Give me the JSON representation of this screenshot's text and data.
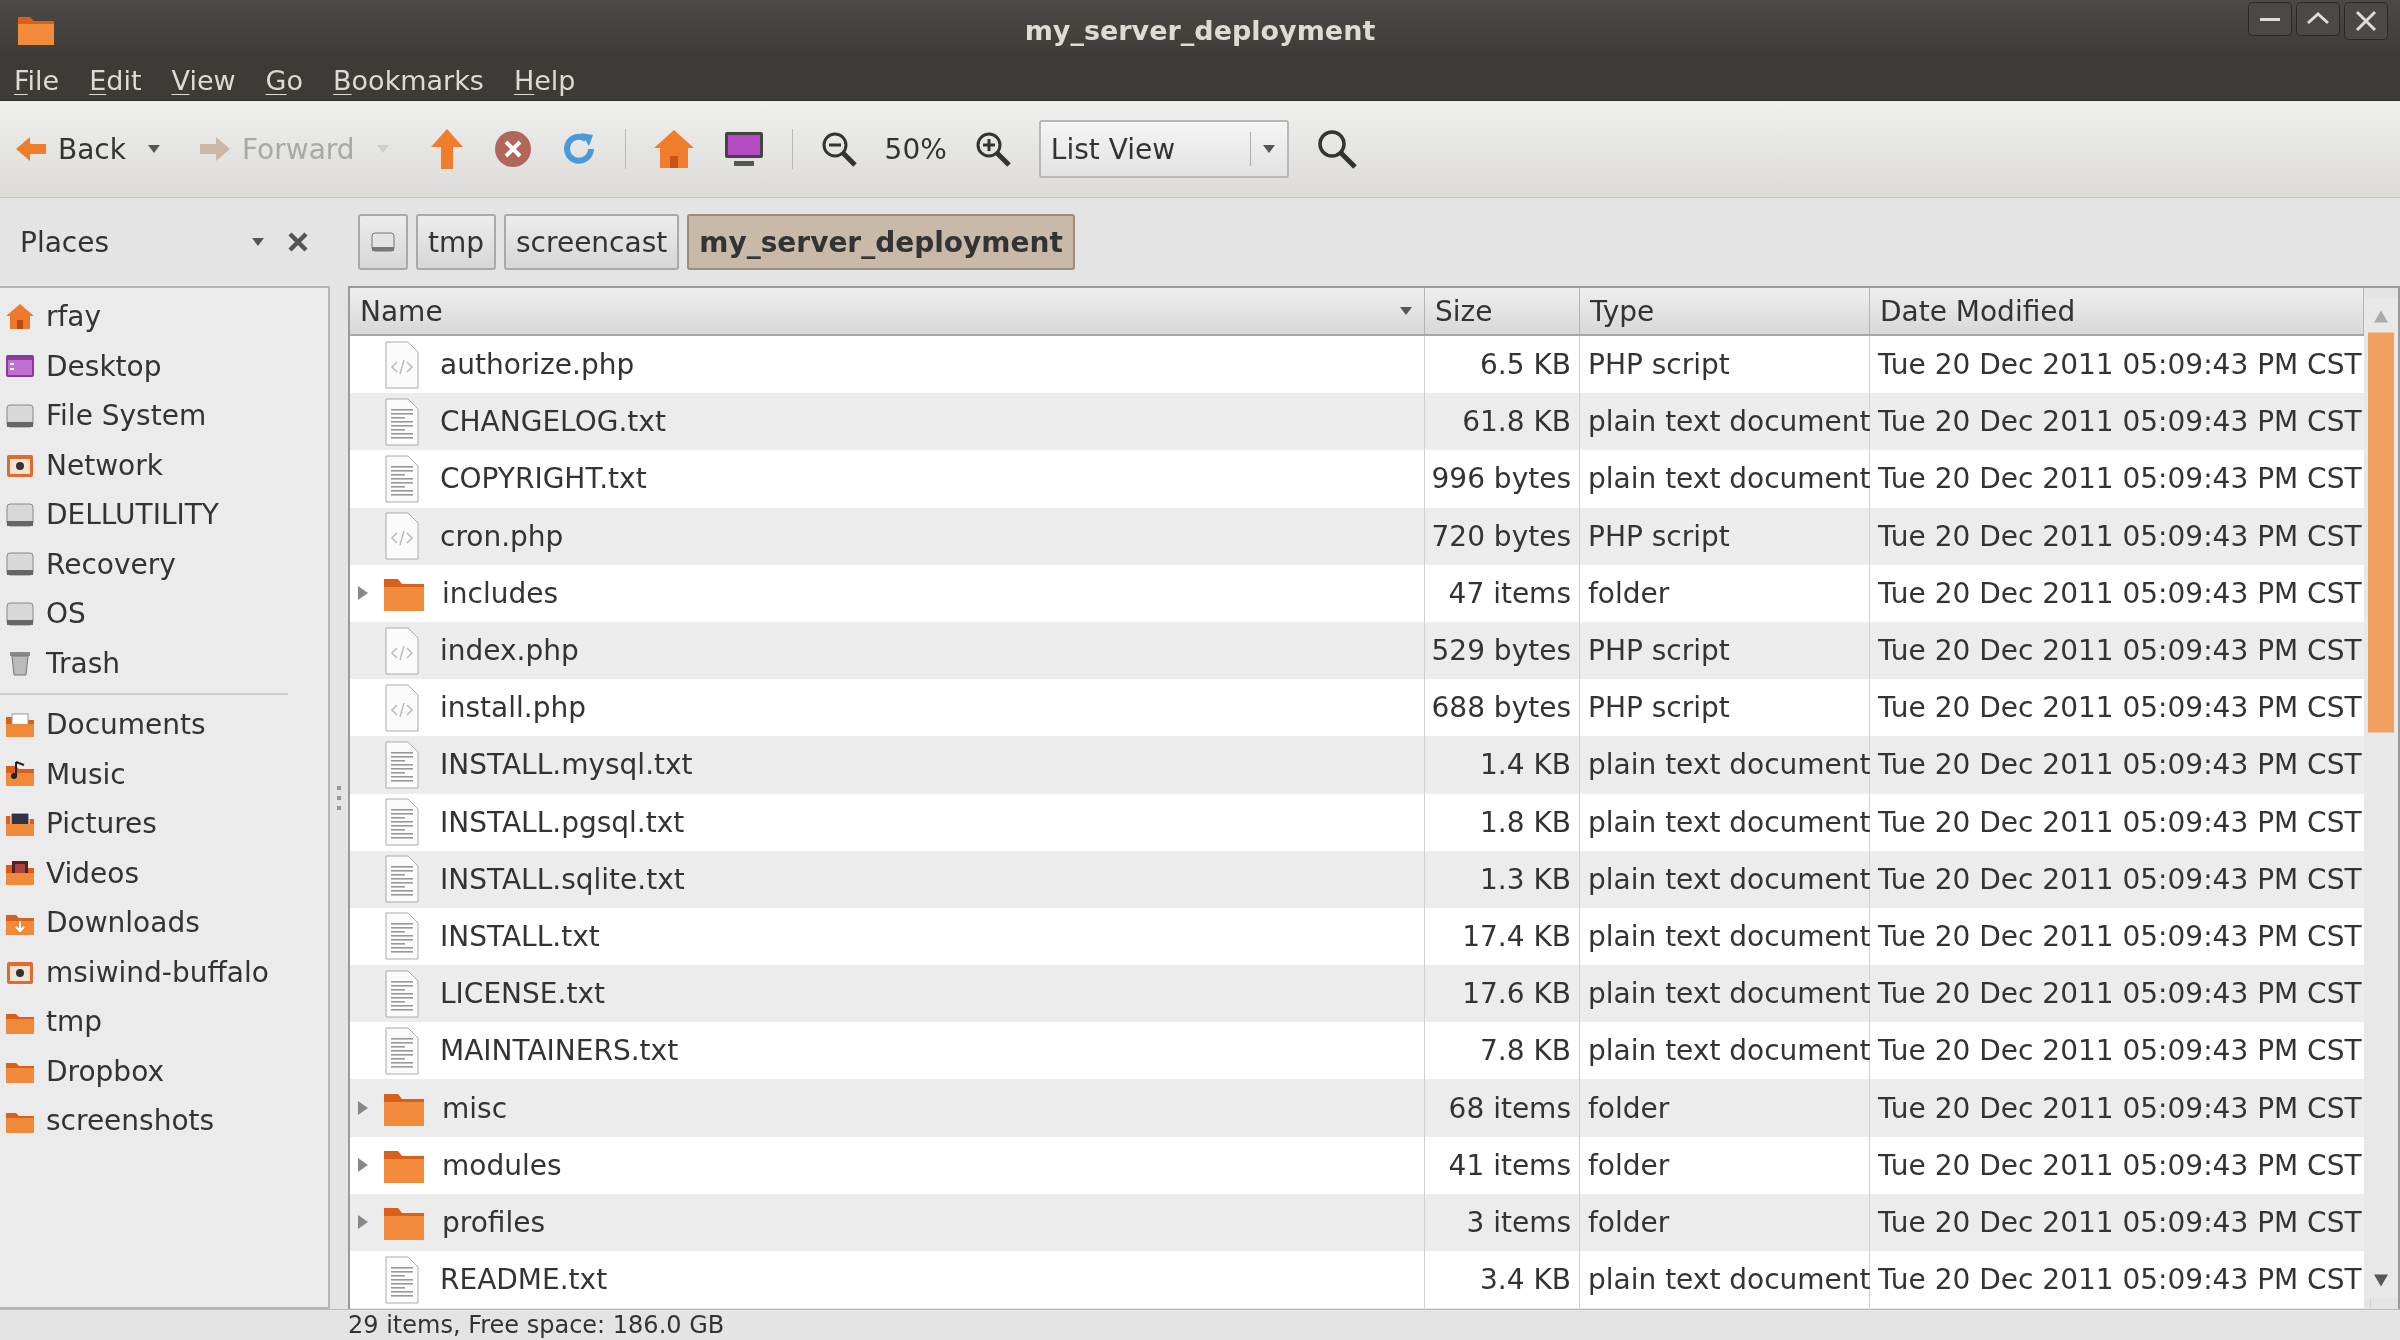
{
  "window": {
    "title": "my_server_deployment"
  },
  "menu": [
    {
      "label": "File"
    },
    {
      "label": "Edit"
    },
    {
      "label": "View"
    },
    {
      "label": "Go"
    },
    {
      "label": "Bookmarks"
    },
    {
      "label": "Help"
    }
  ],
  "toolbar": [
    {
      "kind": "back",
      "label": "Back",
      "disabled": false
    },
    {
      "kind": "forward",
      "label": "Forward",
      "disabled": true
    },
    {
      "kind": "up",
      "disabled": false
    },
    {
      "kind": "stop",
      "disabled": false
    },
    {
      "kind": "reload",
      "disabled": false
    },
    {
      "kind": "sep"
    },
    {
      "kind": "home",
      "disabled": false
    },
    {
      "kind": "computer",
      "disabled": false
    },
    {
      "kind": "sep"
    },
    {
      "kind": "zoom-out",
      "disabled": false
    },
    {
      "kind": "zoom-level",
      "label": "50%"
    },
    {
      "kind": "zoom-in",
      "disabled": false
    },
    {
      "kind": "view",
      "label": "List View"
    },
    {
      "kind": "search",
      "disabled": false
    }
  ],
  "sidebar": {
    "title": "Places",
    "groups": [
      [
        {
          "kind": "home",
          "label": "rfay"
        },
        {
          "kind": "desktop",
          "label": "Desktop"
        },
        {
          "kind": "drive",
          "label": "File System"
        },
        {
          "kind": "network",
          "label": "Network"
        },
        {
          "kind": "drive",
          "label": "DELLUTILITY"
        },
        {
          "kind": "drive",
          "label": "Recovery"
        },
        {
          "kind": "drive",
          "label": "OS"
        },
        {
          "kind": "trash",
          "label": "Trash"
        }
      ],
      [
        {
          "kind": "documents",
          "label": "Documents"
        },
        {
          "kind": "music",
          "label": "Music"
        },
        {
          "kind": "pictures",
          "label": "Pictures"
        },
        {
          "kind": "videos",
          "label": "Videos"
        },
        {
          "kind": "downloads",
          "label": "Downloads"
        },
        {
          "kind": "network",
          "label": "msiwind-buffalo"
        },
        {
          "kind": "folder",
          "label": "tmp"
        },
        {
          "kind": "folder",
          "label": "Dropbox"
        },
        {
          "kind": "folder",
          "label": "screenshots"
        }
      ]
    ]
  },
  "path": [
    {
      "kind": "drive",
      "selected": false
    },
    {
      "kind": "text",
      "label": "tmp",
      "selected": false
    },
    {
      "kind": "text",
      "label": "screencast",
      "selected": false
    },
    {
      "kind": "text",
      "label": "my_server_deployment",
      "selected": true
    }
  ],
  "table": {
    "columns": [
      "Name",
      "Size",
      "Type",
      "Date Modified"
    ],
    "rows": [
      {
        "kind": "php",
        "name": "authorize.php",
        "size": "6.5 KB",
        "type": "PHP script",
        "date": "Tue 20 Dec 2011 05:09:43 PM CST"
      },
      {
        "kind": "text",
        "name": "CHANGELOG.txt",
        "size": "61.8 KB",
        "type": "plain text document",
        "date": "Tue 20 Dec 2011 05:09:43 PM CST"
      },
      {
        "kind": "text",
        "name": "COPYRIGHT.txt",
        "size": "996 bytes",
        "type": "plain text document",
        "date": "Tue 20 Dec 2011 05:09:43 PM CST"
      },
      {
        "kind": "php",
        "name": "cron.php",
        "size": "720 bytes",
        "type": "PHP script",
        "date": "Tue 20 Dec 2011 05:09:43 PM CST"
      },
      {
        "kind": "folder",
        "expanded": false,
        "name": "includes",
        "size": "47 items",
        "type": "folder",
        "date": "Tue 20 Dec 2011 05:09:43 PM CST"
      },
      {
        "kind": "php",
        "name": "index.php",
        "size": "529 bytes",
        "type": "PHP script",
        "date": "Tue 20 Dec 2011 05:09:43 PM CST"
      },
      {
        "kind": "php",
        "name": "install.php",
        "size": "688 bytes",
        "type": "PHP script",
        "date": "Tue 20 Dec 2011 05:09:43 PM CST"
      },
      {
        "kind": "text",
        "name": "INSTALL.mysql.txt",
        "size": "1.4 KB",
        "type": "plain text document",
        "date": "Tue 20 Dec 2011 05:09:43 PM CST"
      },
      {
        "kind": "text",
        "name": "INSTALL.pgsql.txt",
        "size": "1.8 KB",
        "type": "plain text document",
        "date": "Tue 20 Dec 2011 05:09:43 PM CST"
      },
      {
        "kind": "text",
        "name": "INSTALL.sqlite.txt",
        "size": "1.3 KB",
        "type": "plain text document",
        "date": "Tue 20 Dec 2011 05:09:43 PM CST"
      },
      {
        "kind": "text",
        "name": "INSTALL.txt",
        "size": "17.4 KB",
        "type": "plain text document",
        "date": "Tue 20 Dec 2011 05:09:43 PM CST"
      },
      {
        "kind": "text",
        "name": "LICENSE.txt",
        "size": "17.6 KB",
        "type": "plain text document",
        "date": "Tue 20 Dec 2011 05:09:43 PM CST"
      },
      {
        "kind": "text",
        "name": "MAINTAINERS.txt",
        "size": "7.8 KB",
        "type": "plain text document",
        "date": "Tue 20 Dec 2011 05:09:43 PM CST"
      },
      {
        "kind": "folder",
        "expanded": false,
        "name": "misc",
        "size": "68 items",
        "type": "folder",
        "date": "Tue 20 Dec 2011 05:09:43 PM CST"
      },
      {
        "kind": "folder",
        "expanded": false,
        "name": "modules",
        "size": "41 items",
        "type": "folder",
        "date": "Tue 20 Dec 2011 05:09:43 PM CST"
      },
      {
        "kind": "folder",
        "expanded": false,
        "name": "profiles",
        "size": "3 items",
        "type": "folder",
        "date": "Tue 20 Dec 2011 05:09:43 PM CST"
      },
      {
        "kind": "text",
        "name": "README.txt",
        "size": "3.4 KB",
        "type": "plain text document",
        "date": "Tue 20 Dec 2011 05:09:43 PM CST"
      }
    ]
  },
  "status_bar": "29 items, Free space: 186.0 GB"
}
